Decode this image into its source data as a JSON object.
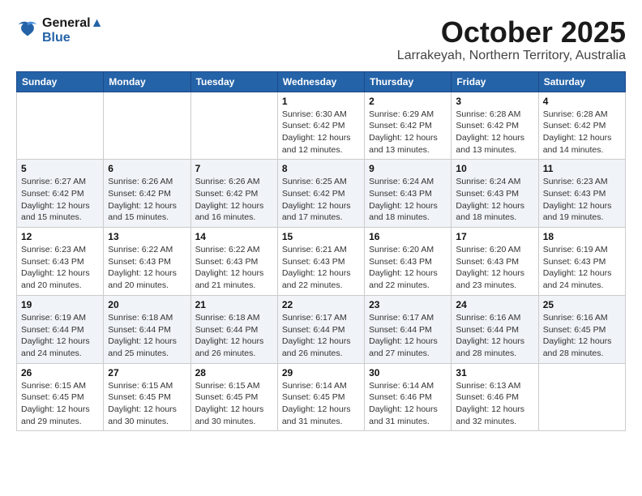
{
  "logo": {
    "line1": "General",
    "line2": "Blue"
  },
  "title": "October 2025",
  "subtitle": "Larrakeyah, Northern Territory, Australia",
  "weekdays": [
    "Sunday",
    "Monday",
    "Tuesday",
    "Wednesday",
    "Thursday",
    "Friday",
    "Saturday"
  ],
  "weeks": [
    [
      {
        "day": "",
        "info": ""
      },
      {
        "day": "",
        "info": ""
      },
      {
        "day": "",
        "info": ""
      },
      {
        "day": "1",
        "info": "Sunrise: 6:30 AM\nSunset: 6:42 PM\nDaylight: 12 hours\nand 12 minutes."
      },
      {
        "day": "2",
        "info": "Sunrise: 6:29 AM\nSunset: 6:42 PM\nDaylight: 12 hours\nand 13 minutes."
      },
      {
        "day": "3",
        "info": "Sunrise: 6:28 AM\nSunset: 6:42 PM\nDaylight: 12 hours\nand 13 minutes."
      },
      {
        "day": "4",
        "info": "Sunrise: 6:28 AM\nSunset: 6:42 PM\nDaylight: 12 hours\nand 14 minutes."
      }
    ],
    [
      {
        "day": "5",
        "info": "Sunrise: 6:27 AM\nSunset: 6:42 PM\nDaylight: 12 hours\nand 15 minutes."
      },
      {
        "day": "6",
        "info": "Sunrise: 6:26 AM\nSunset: 6:42 PM\nDaylight: 12 hours\nand 15 minutes."
      },
      {
        "day": "7",
        "info": "Sunrise: 6:26 AM\nSunset: 6:42 PM\nDaylight: 12 hours\nand 16 minutes."
      },
      {
        "day": "8",
        "info": "Sunrise: 6:25 AM\nSunset: 6:42 PM\nDaylight: 12 hours\nand 17 minutes."
      },
      {
        "day": "9",
        "info": "Sunrise: 6:24 AM\nSunset: 6:43 PM\nDaylight: 12 hours\nand 18 minutes."
      },
      {
        "day": "10",
        "info": "Sunrise: 6:24 AM\nSunset: 6:43 PM\nDaylight: 12 hours\nand 18 minutes."
      },
      {
        "day": "11",
        "info": "Sunrise: 6:23 AM\nSunset: 6:43 PM\nDaylight: 12 hours\nand 19 minutes."
      }
    ],
    [
      {
        "day": "12",
        "info": "Sunrise: 6:23 AM\nSunset: 6:43 PM\nDaylight: 12 hours\nand 20 minutes."
      },
      {
        "day": "13",
        "info": "Sunrise: 6:22 AM\nSunset: 6:43 PM\nDaylight: 12 hours\nand 20 minutes."
      },
      {
        "day": "14",
        "info": "Sunrise: 6:22 AM\nSunset: 6:43 PM\nDaylight: 12 hours\nand 21 minutes."
      },
      {
        "day": "15",
        "info": "Sunrise: 6:21 AM\nSunset: 6:43 PM\nDaylight: 12 hours\nand 22 minutes."
      },
      {
        "day": "16",
        "info": "Sunrise: 6:20 AM\nSunset: 6:43 PM\nDaylight: 12 hours\nand 22 minutes."
      },
      {
        "day": "17",
        "info": "Sunrise: 6:20 AM\nSunset: 6:43 PM\nDaylight: 12 hours\nand 23 minutes."
      },
      {
        "day": "18",
        "info": "Sunrise: 6:19 AM\nSunset: 6:43 PM\nDaylight: 12 hours\nand 24 minutes."
      }
    ],
    [
      {
        "day": "19",
        "info": "Sunrise: 6:19 AM\nSunset: 6:44 PM\nDaylight: 12 hours\nand 24 minutes."
      },
      {
        "day": "20",
        "info": "Sunrise: 6:18 AM\nSunset: 6:44 PM\nDaylight: 12 hours\nand 25 minutes."
      },
      {
        "day": "21",
        "info": "Sunrise: 6:18 AM\nSunset: 6:44 PM\nDaylight: 12 hours\nand 26 minutes."
      },
      {
        "day": "22",
        "info": "Sunrise: 6:17 AM\nSunset: 6:44 PM\nDaylight: 12 hours\nand 26 minutes."
      },
      {
        "day": "23",
        "info": "Sunrise: 6:17 AM\nSunset: 6:44 PM\nDaylight: 12 hours\nand 27 minutes."
      },
      {
        "day": "24",
        "info": "Sunrise: 6:16 AM\nSunset: 6:44 PM\nDaylight: 12 hours\nand 28 minutes."
      },
      {
        "day": "25",
        "info": "Sunrise: 6:16 AM\nSunset: 6:45 PM\nDaylight: 12 hours\nand 28 minutes."
      }
    ],
    [
      {
        "day": "26",
        "info": "Sunrise: 6:15 AM\nSunset: 6:45 PM\nDaylight: 12 hours\nand 29 minutes."
      },
      {
        "day": "27",
        "info": "Sunrise: 6:15 AM\nSunset: 6:45 PM\nDaylight: 12 hours\nand 30 minutes."
      },
      {
        "day": "28",
        "info": "Sunrise: 6:15 AM\nSunset: 6:45 PM\nDaylight: 12 hours\nand 30 minutes."
      },
      {
        "day": "29",
        "info": "Sunrise: 6:14 AM\nSunset: 6:45 PM\nDaylight: 12 hours\nand 31 minutes."
      },
      {
        "day": "30",
        "info": "Sunrise: 6:14 AM\nSunset: 6:46 PM\nDaylight: 12 hours\nand 31 minutes."
      },
      {
        "day": "31",
        "info": "Sunrise: 6:13 AM\nSunset: 6:46 PM\nDaylight: 12 hours\nand 32 minutes."
      },
      {
        "day": "",
        "info": ""
      }
    ]
  ]
}
